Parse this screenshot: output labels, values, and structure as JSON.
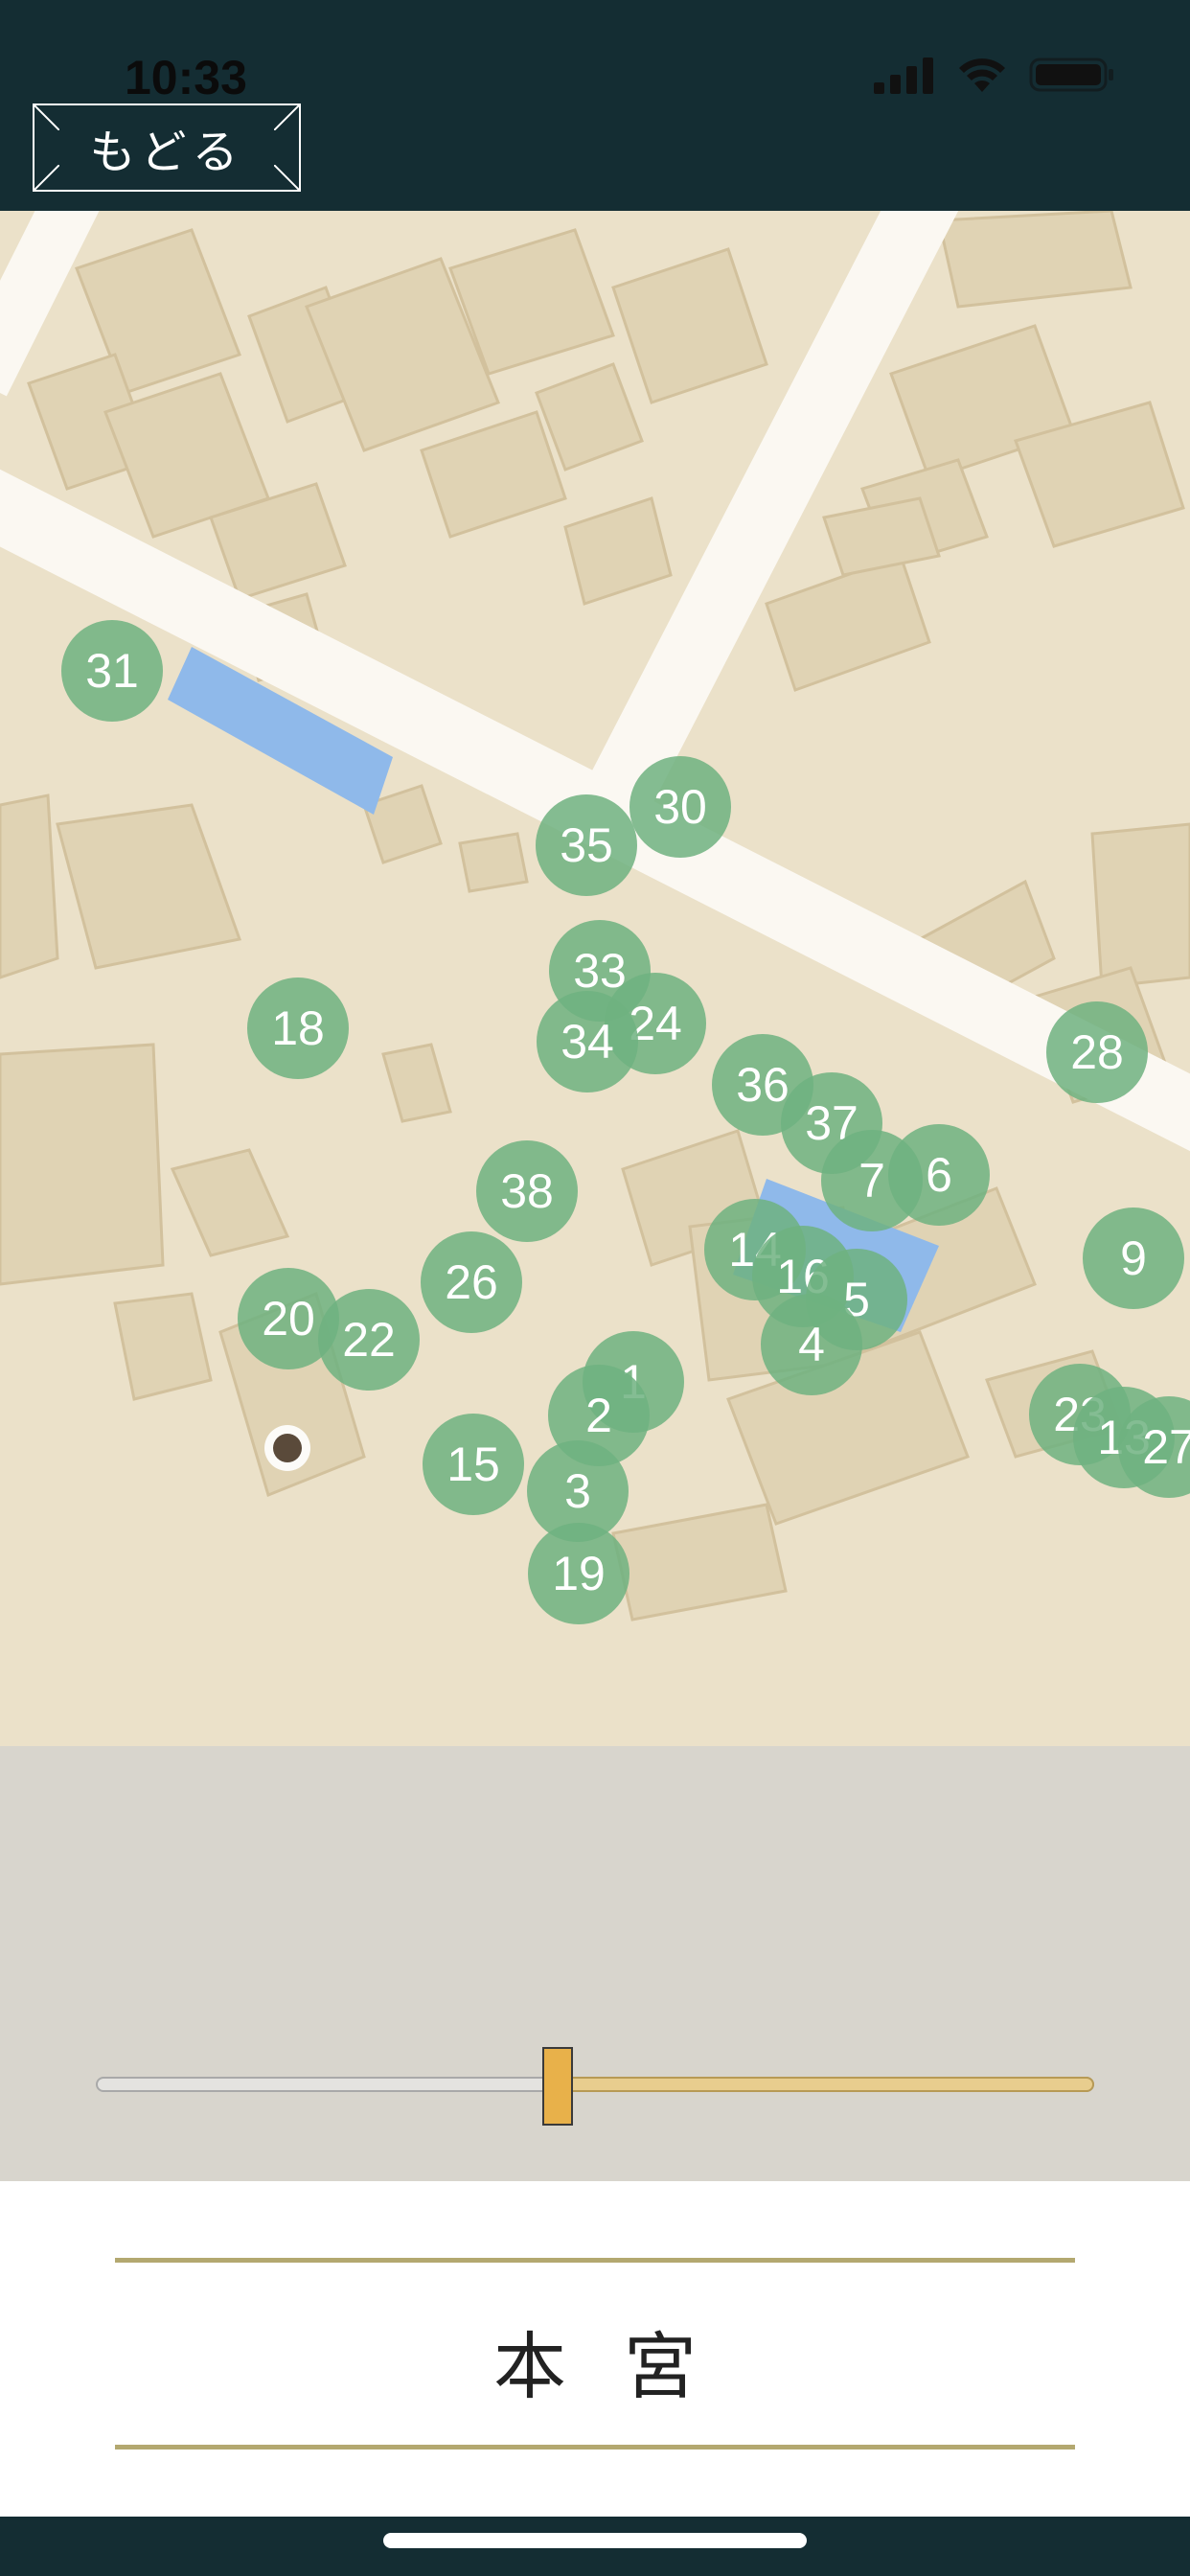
{
  "status_bar": {
    "time": "10:33"
  },
  "header": {
    "back_label": "もどる"
  },
  "map": {
    "markers": [
      {
        "label": "31"
      },
      {
        "label": "30"
      },
      {
        "label": "35"
      },
      {
        "label": "33"
      },
      {
        "label": "24"
      },
      {
        "label": "34"
      },
      {
        "label": "18"
      },
      {
        "label": "36"
      },
      {
        "label": "37"
      },
      {
        "label": "28"
      },
      {
        "label": "6"
      },
      {
        "label": "7"
      },
      {
        "label": "38"
      },
      {
        "label": "9"
      },
      {
        "label": "14"
      },
      {
        "label": "16"
      },
      {
        "label": "5"
      },
      {
        "label": "26"
      },
      {
        "label": "4"
      },
      {
        "label": "20"
      },
      {
        "label": "22"
      },
      {
        "label": "1"
      },
      {
        "label": "2"
      },
      {
        "label": "23"
      },
      {
        "label": "13"
      },
      {
        "label": "27"
      },
      {
        "label": "15"
      },
      {
        "label": "3"
      },
      {
        "label": "19"
      }
    ]
  },
  "slider": {
    "value_fraction": 0.46
  },
  "footer": {
    "title": "本宮"
  },
  "colors": {
    "header_bg": "#142d33",
    "marker": "#6eb280",
    "slider_thumb": "#e8b14a",
    "rule": "#b3a870",
    "map_bg": "#ebe1c9"
  }
}
